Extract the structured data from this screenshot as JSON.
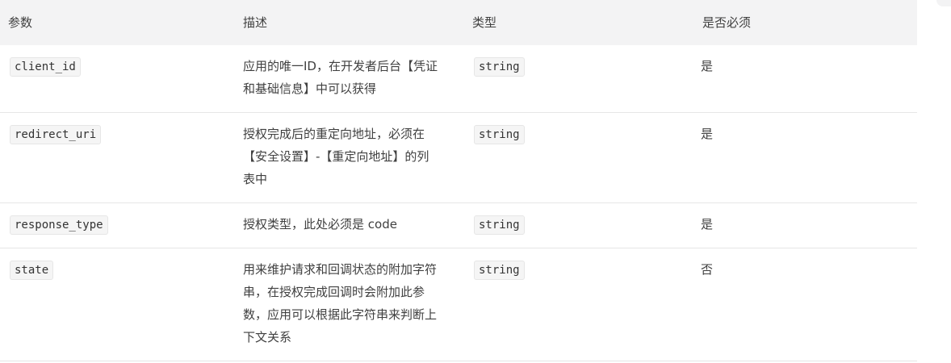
{
  "table": {
    "headers": [
      "参数",
      "描述",
      "类型",
      "是否必须"
    ],
    "rows": [
      {
        "param": "client_id",
        "description": "应用的唯一ID，在开发者后台【凭证和基础信息】中可以获得",
        "type": "string",
        "required": "是"
      },
      {
        "param": "redirect_uri",
        "description": "授权完成后的重定向地址，必须在【安全设置】-【重定向地址】的列表中",
        "type": "string",
        "required": "是"
      },
      {
        "param": "response_type",
        "description": "授权类型，此处必须是 code",
        "type": "string",
        "required": "是"
      },
      {
        "param": "state",
        "description": "用来维护请求和回调状态的附加字符串，在授权完成回调时会附加此参数，应用可以根据此字符串来判断上下文关系",
        "type": "string",
        "required": "否"
      }
    ]
  },
  "colors": {
    "header_bg": "#f3f3f4",
    "border": "#e6e6e6",
    "text": "#404040",
    "code_bg": "#f5f5f5"
  }
}
